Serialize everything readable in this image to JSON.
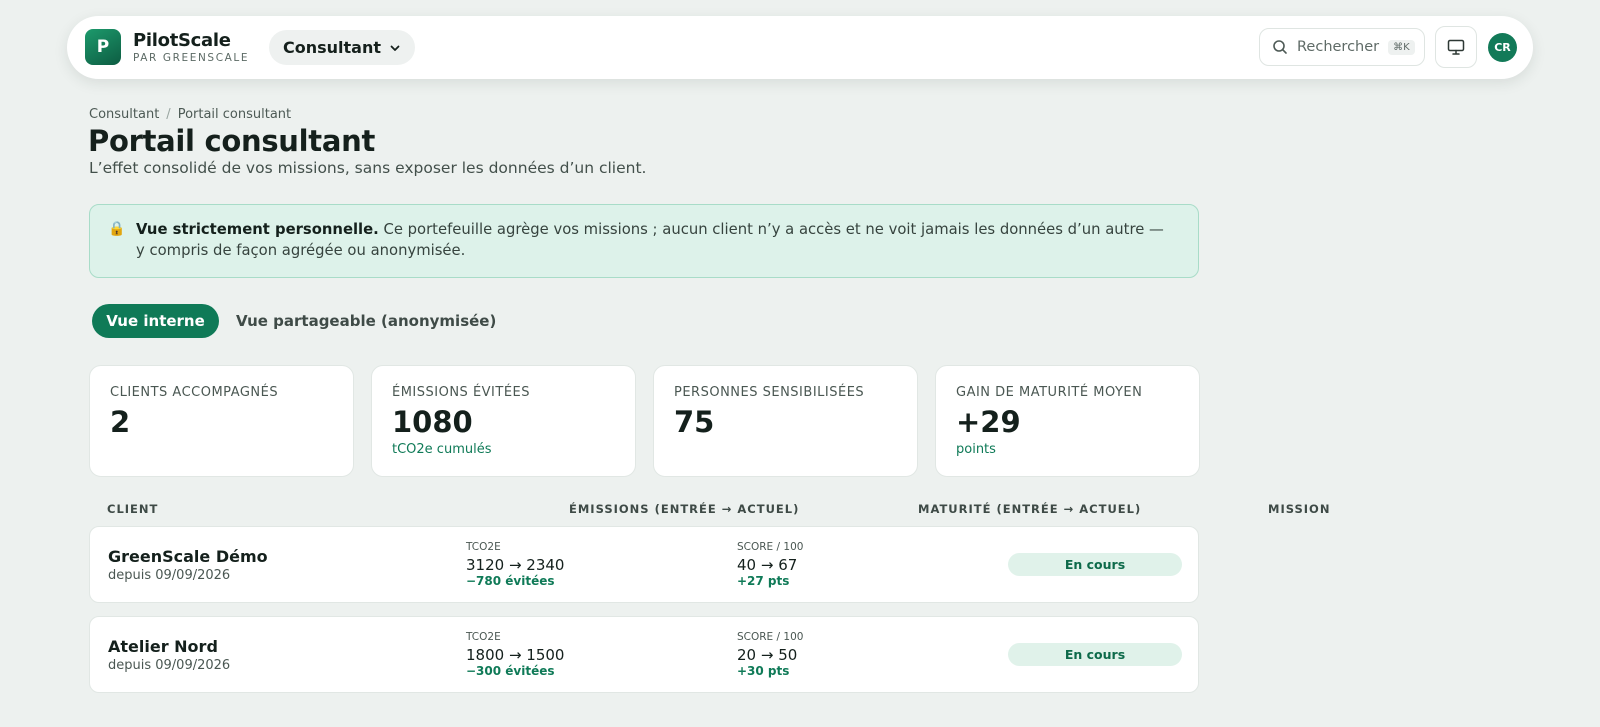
{
  "app": {
    "logo_letter": "P",
    "name": "PilotScale",
    "subtitle": "PAR GREENSCALE",
    "brand_color": "#0f7a57"
  },
  "topbar": {
    "role": "Consultant",
    "search_placeholder": "Rechercher",
    "search_shortcut": "⌘K",
    "avatar_initials": "CR"
  },
  "breadcrumb": [
    "Consultant",
    "Portail consultant"
  ],
  "page": {
    "title": "Portail consultant",
    "subtitle": "L’effet consolidé de vos missions, sans exposer les données d’un client."
  },
  "notice": {
    "icon": "lock-icon",
    "title": "Vue strictement personnelle.",
    "body": "Ce portefeuille agrège vos missions ; aucun client n’y a accès et ne voit jamais les données d’un autre — y compris de façon agrégée ou anonymisée."
  },
  "tabs": [
    {
      "label": "Vue interne",
      "active": true
    },
    {
      "label": "Vue partageable (anonymisée)",
      "active": false
    }
  ],
  "stats": [
    {
      "label": "CLIENTS ACCOMPAGNÉS",
      "value": "2",
      "unit": ""
    },
    {
      "label": "ÉMISSIONS ÉVITÉES",
      "value": "1080",
      "unit": "tCO2e cumulés"
    },
    {
      "label": "PERSONNES SENSIBILISÉES",
      "value": "75",
      "unit": ""
    },
    {
      "label": "GAIN DE MATURITÉ MOYEN",
      "value": "+29",
      "unit": "points"
    }
  ],
  "table": {
    "headers": {
      "client": "CLIENT",
      "emissions": "ÉMISSIONS (ENTRÉE → ACTUEL)",
      "maturity": "MATURITÉ (ENTRÉE → ACTUEL)",
      "mission": "MISSION"
    },
    "rows": [
      {
        "name": "GreenScale Démo",
        "since": "depuis 09/09/2026",
        "emissions_label": "TCO2E",
        "emissions_value": "3120 → 2340",
        "emissions_delta": "−780 évitées",
        "maturity_label": "SCORE / 100",
        "maturity_value": "40 → 67",
        "maturity_delta": "+27 pts",
        "status": "En cours"
      },
      {
        "name": "Atelier Nord",
        "since": "depuis 09/09/2026",
        "emissions_label": "TCO2E",
        "emissions_value": "1800 → 1500",
        "emissions_delta": "−300 évitées",
        "maturity_label": "SCORE / 100",
        "maturity_value": "20 → 50",
        "maturity_delta": "+30 pts",
        "status": "En cours"
      }
    ]
  }
}
